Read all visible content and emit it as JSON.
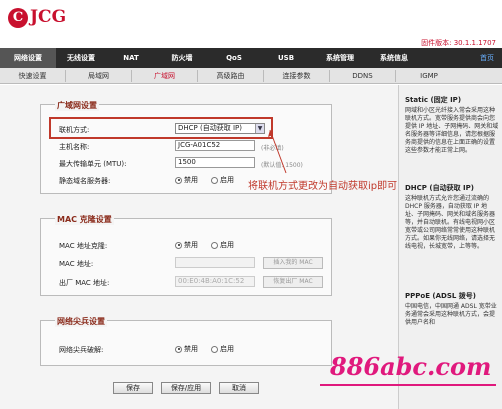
{
  "header": {
    "logo_mark": "C",
    "logo_text": "JCG",
    "firmware": "固件版本: 30.1.1.1707"
  },
  "nav": {
    "items": [
      {
        "label": "网络设置",
        "active": true
      },
      {
        "label": "无线设置",
        "active": false
      },
      {
        "label": "NAT",
        "active": false
      },
      {
        "label": "防火墙",
        "active": false
      },
      {
        "label": "QoS",
        "active": false
      },
      {
        "label": "USB",
        "active": false
      },
      {
        "label": "系统管理",
        "active": false
      },
      {
        "label": "系统信息",
        "active": false
      }
    ],
    "home": "首页"
  },
  "subnav": {
    "items": [
      {
        "label": "快速设置",
        "active": false
      },
      {
        "label": "局域网",
        "active": false
      },
      {
        "label": "广域网",
        "active": true
      },
      {
        "label": "高级路由",
        "active": false
      },
      {
        "label": "连接参数",
        "active": false
      },
      {
        "label": "DDNS",
        "active": false
      },
      {
        "label": "IGMP",
        "active": false
      }
    ]
  },
  "wan": {
    "title": "广域网设置",
    "conn_label": "联机方式:",
    "conn_value": "DHCP (自动获取 IP)",
    "host_label": "主机名称:",
    "host_value": "JCG-A01C52",
    "host_hint": "(非必填)",
    "mtu_label": "最大传输单元 (MTU):",
    "mtu_value": "1500",
    "mtu_hint": "(默认值: 1500)",
    "dns_label": "静态域名服务器:",
    "opt_disable": "禁用",
    "opt_enable": "启用"
  },
  "mac": {
    "title": "MAC 克隆设置",
    "clone_label": "MAC 地址克隆:",
    "addr_label": "MAC 地址:",
    "factory_label": "出厂 MAC 地址:",
    "factory_value": "00:E0:4B:A0:1C:52",
    "btn_insert": "插入我的 MAC",
    "btn_restore": "恢复出厂 MAC",
    "opt_disable": "禁用",
    "opt_enable": "启用"
  },
  "wormhole": {
    "title": "网络尖兵设置",
    "crack_label": "网络尖兵破解:",
    "opt_disable": "禁用",
    "opt_enable": "启用"
  },
  "annotation": {
    "note": "将联机方式更改为自动获取ip即可"
  },
  "buttons": {
    "save": "保存",
    "save_apply": "保存/应用",
    "cancel": "取消"
  },
  "sidebar": {
    "static_head": "Static (固定 IP)",
    "static_text": "网域和小区光纤接入常会采用这种联机方式。宽带服务提供商会向您提供 IP 地址、子网掩码、网关和域名服务器等详细信息，请您根据服务商提供的信息在上面正确的设置这些参数才能正常上网。",
    "dhcp_head": "DHCP (自动获取 IP)",
    "dhcp_text": "这种联机方式允许您通过流确的 DHCP 服务器，自动获取 IP 地址、子网掩码、网关和域名服务器等，并自动联机。有线电视网小区宽带或公司网络常常使用这种联机方式。如果你无线网络，请选择无线电视，长城宽带，上等等。",
    "pppoe_head": "PPPoE (ADSL 拨号)",
    "pppoe_text": "中国电信，中国网通 ADSL 宽带业务通常会采用这种联机方式，会提供用户名和"
  },
  "watermark": "886abc.com"
}
